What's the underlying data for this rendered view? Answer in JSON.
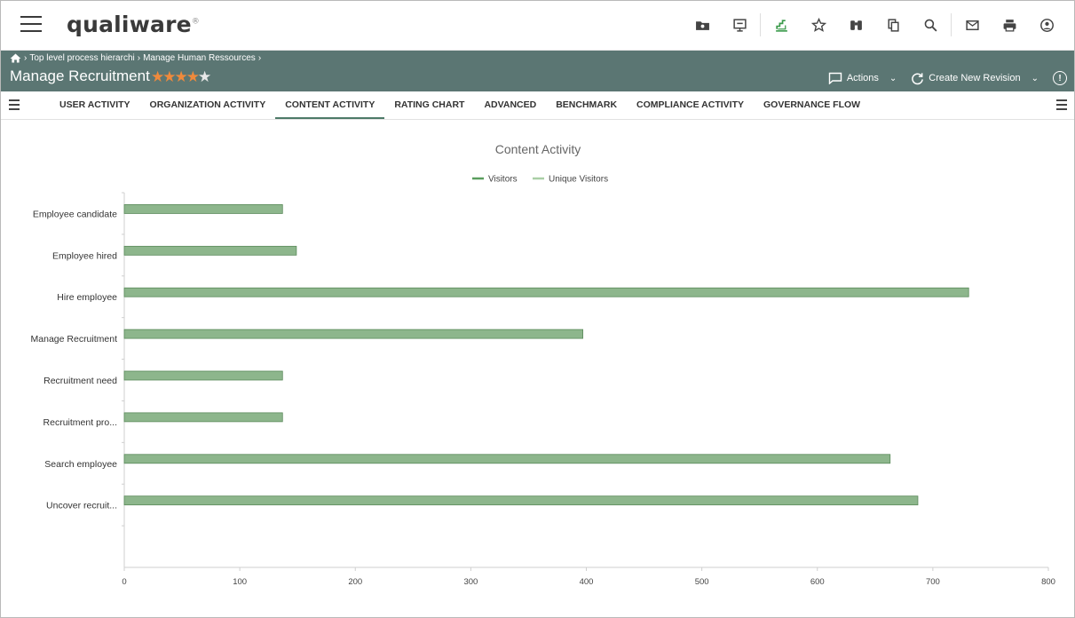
{
  "app": {
    "logo_text": "qualiware",
    "logo_mark": "®"
  },
  "toolbar_icons": [
    {
      "name": "folder-icon"
    },
    {
      "name": "presentation-icon"
    },
    {
      "name": "stairs-chart-icon",
      "color": "#3a9a4a"
    },
    {
      "name": "star-icon"
    },
    {
      "name": "binoculars-icon"
    },
    {
      "name": "copy-icon"
    },
    {
      "name": "search-icon"
    },
    {
      "name": "mail-icon"
    },
    {
      "name": "print-icon"
    },
    {
      "name": "user-circle-icon"
    }
  ],
  "breadcrumb": {
    "items": [
      "Top level process hierarchi",
      "Manage Human Ressources"
    ]
  },
  "page": {
    "title": "Manage Recruitment",
    "rating": 4,
    "rating_max": 5
  },
  "header_actions": {
    "actions_label": "Actions",
    "revision_label": "Create New Revision",
    "info_glyph": "!"
  },
  "tabs": [
    {
      "label": "USER ACTIVITY",
      "active": false
    },
    {
      "label": "ORGANIZATION ACTIVITY",
      "active": false
    },
    {
      "label": "CONTENT ACTIVITY",
      "active": true
    },
    {
      "label": "RATING CHART",
      "active": false
    },
    {
      "label": "ADVANCED",
      "active": false
    },
    {
      "label": "BENCHMARK",
      "active": false
    },
    {
      "label": "COMPLIANCE ACTIVITY",
      "active": false
    },
    {
      "label": "GOVERNANCE FLOW",
      "active": false
    }
  ],
  "colors": {
    "header_bg": "#5b7673",
    "bar_fill": "#8db68c",
    "bar_stroke": "#5a8a5a",
    "unique_visitors": "#a9cfa6",
    "visitors": "#5a9e5e",
    "active_tab": "#4d7a68"
  },
  "chart_data": {
    "type": "bar",
    "orientation": "horizontal",
    "title": "Content Activity",
    "categories": [
      "Employee candidate",
      "Employee hired",
      "Hire employee",
      "Manage Recruitment",
      "Recruitment need",
      "Recruitment pro...",
      "Search employee",
      "Uncover recruit..."
    ],
    "series": [
      {
        "name": "Visitors",
        "values": [
          137,
          149,
          731,
          397,
          137,
          137,
          663,
          687
        ]
      },
      {
        "name": "Unique Visitors",
        "values": [
          0,
          0,
          0,
          0,
          0,
          0,
          0,
          0
        ]
      }
    ],
    "xlim": [
      0,
      800
    ],
    "xticks": [
      0,
      100,
      200,
      300,
      400,
      500,
      600,
      700,
      800
    ],
    "grid": false,
    "legend_position": "top-center"
  }
}
